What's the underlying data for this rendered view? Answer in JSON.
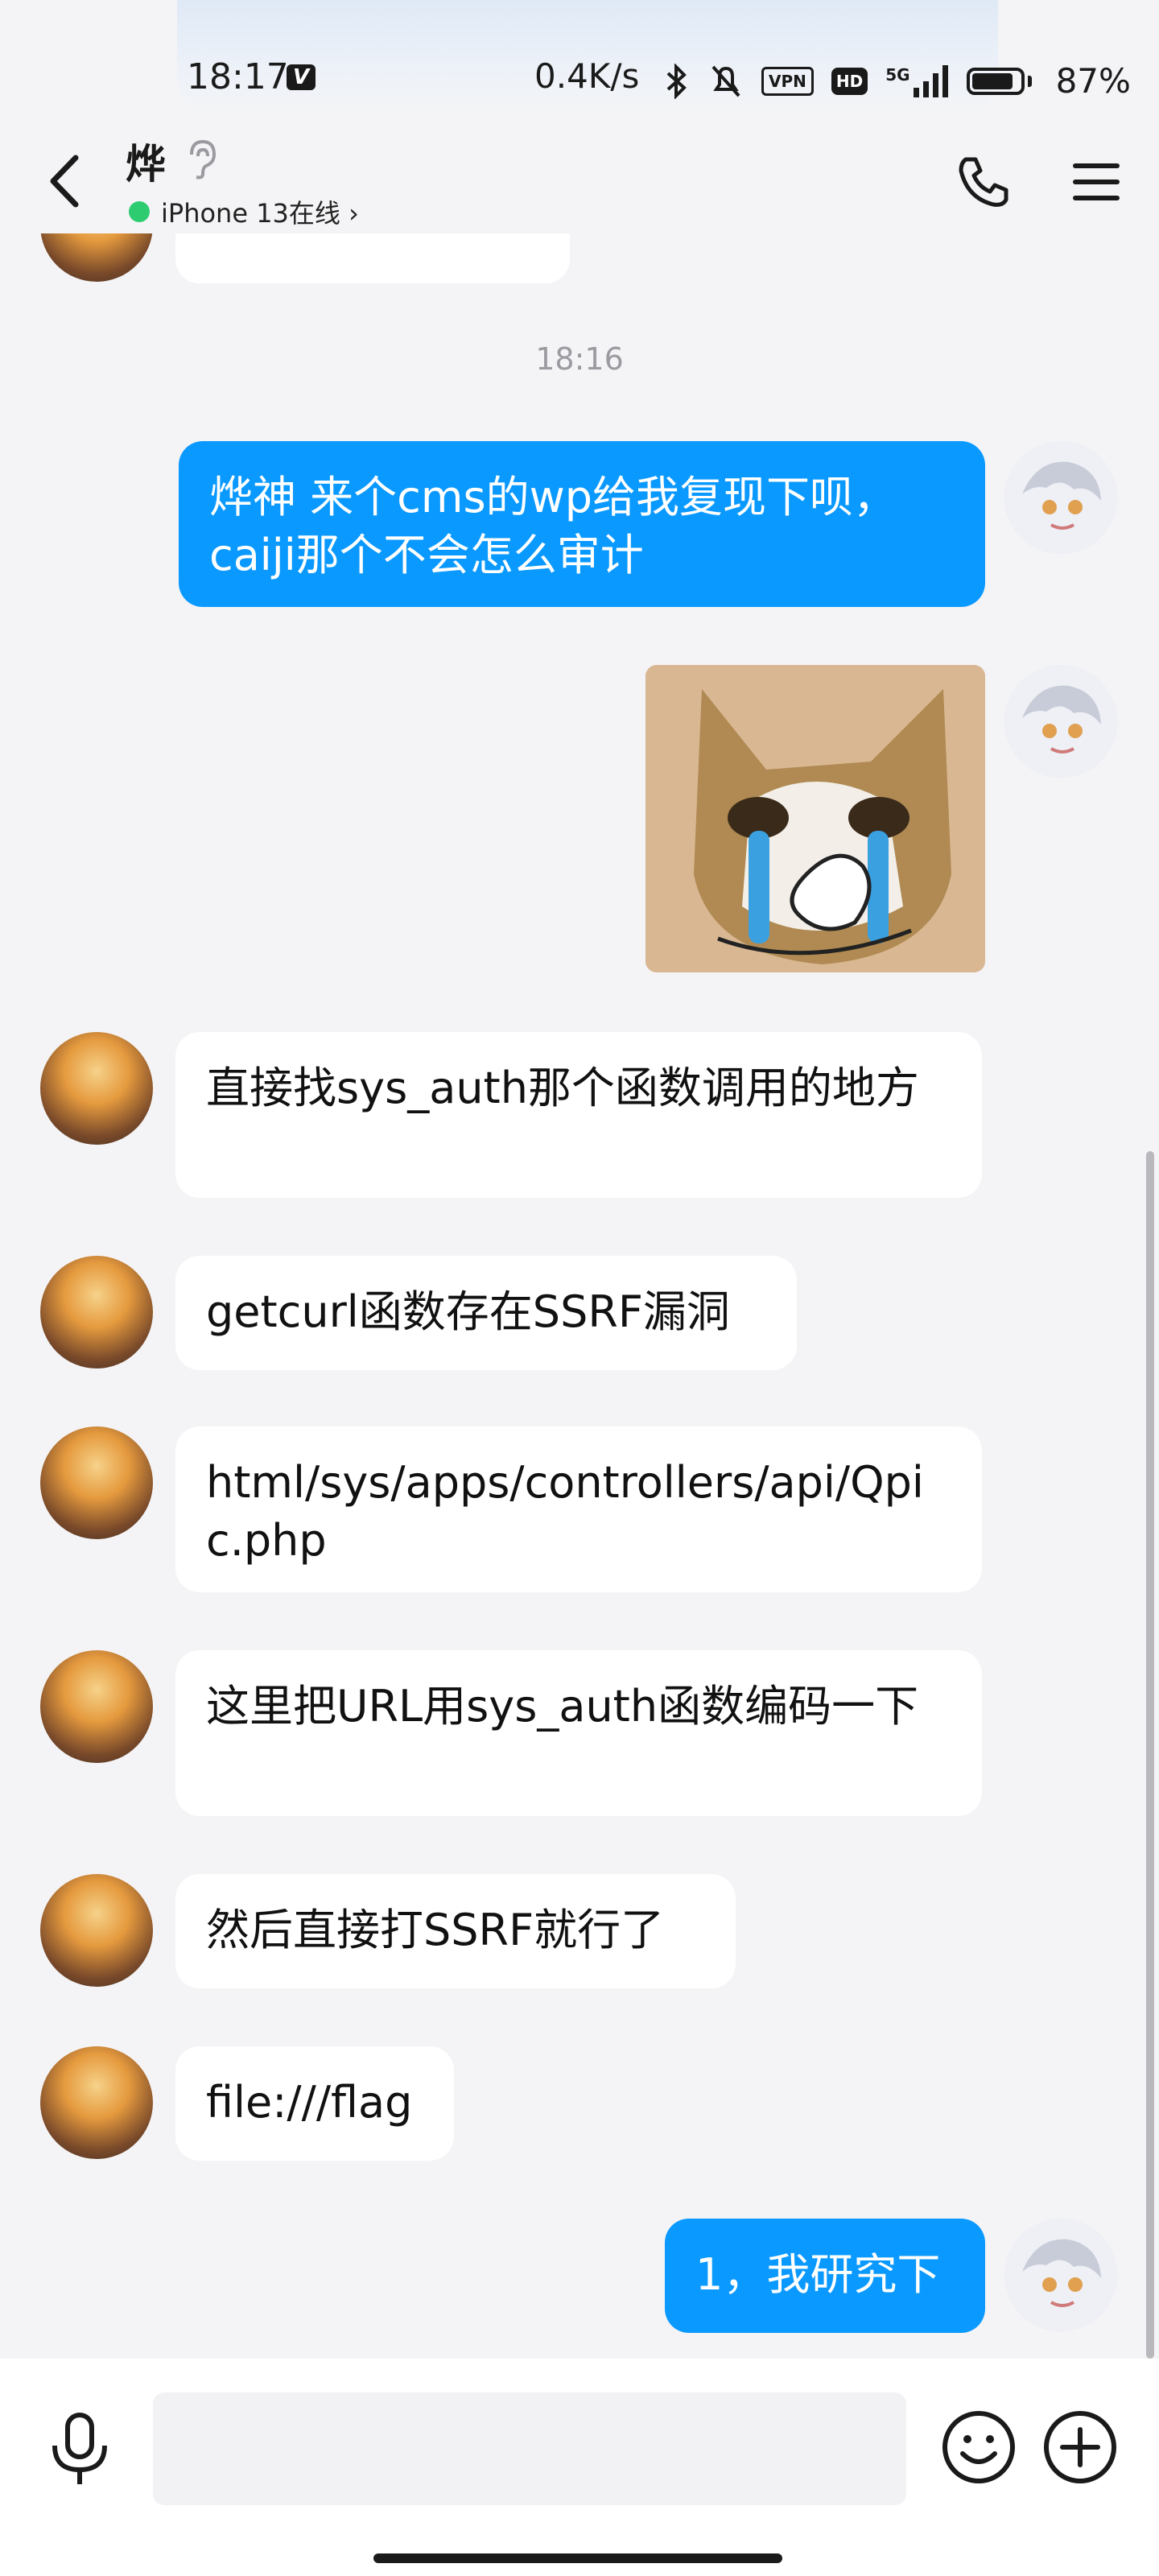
{
  "status": {
    "time": "18:17",
    "v_badge": "V",
    "speed": "0.4K/s",
    "vpn": "VPN",
    "hd": "HD",
    "signal": "5G",
    "battery_percent": "87%",
    "battery_level": 0.87
  },
  "header": {
    "title": "烨",
    "online_status": "iPhone 13在线 ›"
  },
  "messages": [
    {
      "time": "18:16"
    },
    {
      "sender": "me",
      "text": "烨神 来个cms的wp给我复现下呗，caiji那个不会怎么审计"
    },
    {
      "sender": "me",
      "sticker": "crying-cat-sticker"
    },
    {
      "sender": "other",
      "text": "直接找sys_auth那个函数调用的地方"
    },
    {
      "sender": "other",
      "text": "getcurl函数存在SSRF漏洞"
    },
    {
      "sender": "other",
      "text": "html/sys/apps/controllers/api/Qpic.php"
    },
    {
      "sender": "other",
      "text": "这里把URL用sys_auth函数编码一下"
    },
    {
      "sender": "other",
      "text": "然后直接打SSRF就行了"
    },
    {
      "sender": "other",
      "text": "file:///flag"
    },
    {
      "sender": "me",
      "text": "1，我研究下"
    }
  ],
  "input": {
    "placeholder": ""
  },
  "colors": {
    "my_bubble": "#0a99ff",
    "other_bubble": "#ffffff",
    "online_dot": "#2ecc71",
    "background": "#f4f4f6"
  },
  "icons": [
    "back-arrow-icon",
    "ear-icon",
    "phone-icon",
    "menu-icon",
    "microphone-icon",
    "emoji-icon",
    "plus-icon"
  ]
}
